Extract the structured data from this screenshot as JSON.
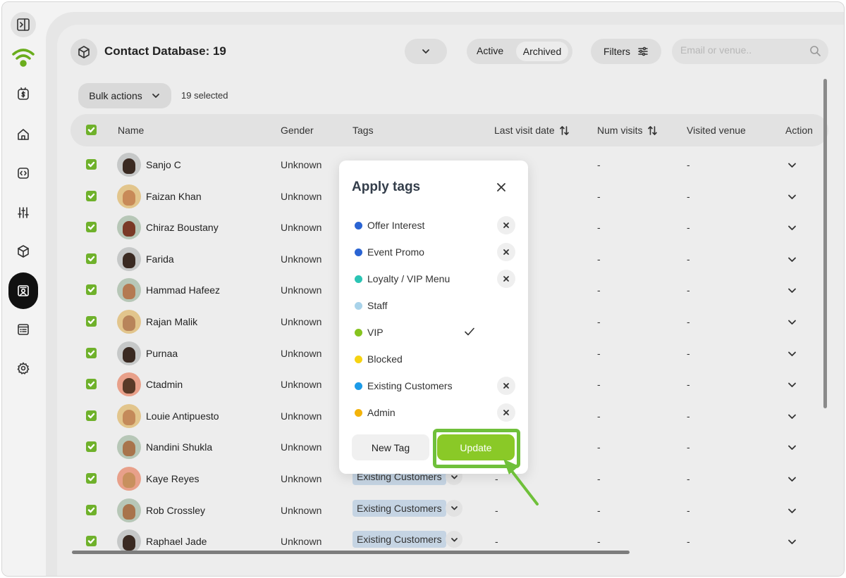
{
  "header": {
    "title": "Contact Database: 19",
    "filter_active": "Active",
    "filter_archived": "Archived",
    "filters_label": "Filters",
    "search_placeholder": "Email or venue.."
  },
  "toolbar": {
    "bulk_actions": "Bulk actions",
    "selected_count": "19 selected"
  },
  "table": {
    "columns": {
      "name": "Name",
      "gender": "Gender",
      "tags": "Tags",
      "last_visit": "Last visit date",
      "num_visits": "Num visits",
      "visited_venue": "Visited venue",
      "action": "Action"
    },
    "rows": [
      {
        "name": "Sanjo C",
        "gender": "Unknown",
        "tag": "",
        "last_visit": "-",
        "num_visits": "-",
        "venue": "-"
      },
      {
        "name": "Faizan Khan",
        "gender": "Unknown",
        "tag": "",
        "last_visit": "-",
        "num_visits": "-",
        "venue": "-"
      },
      {
        "name": "Chiraz Boustany",
        "gender": "Unknown",
        "tag": "",
        "last_visit": "-",
        "num_visits": "-",
        "venue": "-"
      },
      {
        "name": "Farida",
        "gender": "Unknown",
        "tag": "",
        "last_visit": "-",
        "num_visits": "-",
        "venue": "-"
      },
      {
        "name": "Hammad Hafeez",
        "gender": "Unknown",
        "tag": "",
        "last_visit": "-",
        "num_visits": "-",
        "venue": "-"
      },
      {
        "name": "Rajan Malik",
        "gender": "Unknown",
        "tag": "",
        "last_visit": "-",
        "num_visits": "-",
        "venue": "-"
      },
      {
        "name": "Purnaa",
        "gender": "Unknown",
        "tag": "",
        "last_visit": "-",
        "num_visits": "-",
        "venue": "-"
      },
      {
        "name": "Ctadmin",
        "gender": "Unknown",
        "tag": "",
        "last_visit": "-",
        "num_visits": "-",
        "venue": "-"
      },
      {
        "name": "Louie Antipuesto",
        "gender": "Unknown",
        "tag": "",
        "last_visit": "-",
        "num_visits": "-",
        "venue": "-"
      },
      {
        "name": "Nandini Shukla",
        "gender": "Unknown",
        "tag": "",
        "last_visit": "-",
        "num_visits": "-",
        "venue": "-"
      },
      {
        "name": "Kaye Reyes",
        "gender": "Unknown",
        "tag": "Existing Customers",
        "last_visit": "-",
        "num_visits": "-",
        "venue": "-"
      },
      {
        "name": "Rob Crossley",
        "gender": "Unknown",
        "tag": "Existing Customers",
        "last_visit": "-",
        "num_visits": "-",
        "venue": "-"
      },
      {
        "name": "Raphael Jade",
        "gender": "Unknown",
        "tag": "Existing Customers",
        "last_visit": "-",
        "num_visits": "-",
        "venue": "-"
      }
    ]
  },
  "modal": {
    "title": "Apply tags",
    "tags": [
      {
        "label": "Offer Interest",
        "color": "#2a64d3",
        "state": "remove"
      },
      {
        "label": "Event Promo",
        "color": "#2a64d3",
        "state": "remove"
      },
      {
        "label": "Loyalty / VIP Menu",
        "color": "#2bc4b4",
        "state": "remove"
      },
      {
        "label": "Staff",
        "color": "#a9d3ea",
        "state": "none"
      },
      {
        "label": "VIP",
        "color": "#86c41f",
        "state": "check"
      },
      {
        "label": "Blocked",
        "color": "#f6d312",
        "state": "none"
      },
      {
        "label": "Existing Customers",
        "color": "#1c9be8",
        "state": "remove"
      },
      {
        "label": "Admin",
        "color": "#f3b30a",
        "state": "remove"
      }
    ],
    "new_tag_label": "New Tag",
    "update_label": "Update"
  },
  "colors": {
    "accent_green": "#8ac927",
    "checkbox_green": "#6fb12b",
    "highlight_green": "#6fc03a"
  }
}
